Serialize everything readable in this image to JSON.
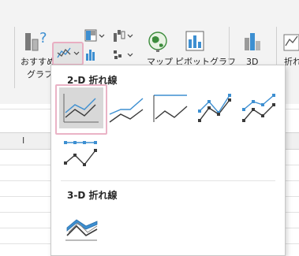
{
  "ribbon": {
    "recommended_label_line1": "おすすめ",
    "recommended_label_line2": "グラフ",
    "maps_label": "マップ",
    "pivot_label": "ピボットグラフ",
    "threed_label": "3D",
    "sparkline_label": "折れ"
  },
  "dropdown": {
    "section_2d_title": "2-D 折れ線",
    "section_3d_title": "3-D 折れ線",
    "chart_types_2d": [
      "line",
      "stacked-line",
      "100-stacked-line",
      "line-with-markers",
      "stacked-line-with-markers",
      "100-stacked-line-with-markers"
    ],
    "chart_types_3d": [
      "3d-line"
    ],
    "selected": "line"
  },
  "sheet": {
    "column_header_partial": "I"
  },
  "colors": {
    "accent_blue": "#3d8fd1",
    "dark_line": "#3a3a3a",
    "selection_pink": "#e9aec2",
    "ribbon_bg": "#f3f3f3"
  }
}
